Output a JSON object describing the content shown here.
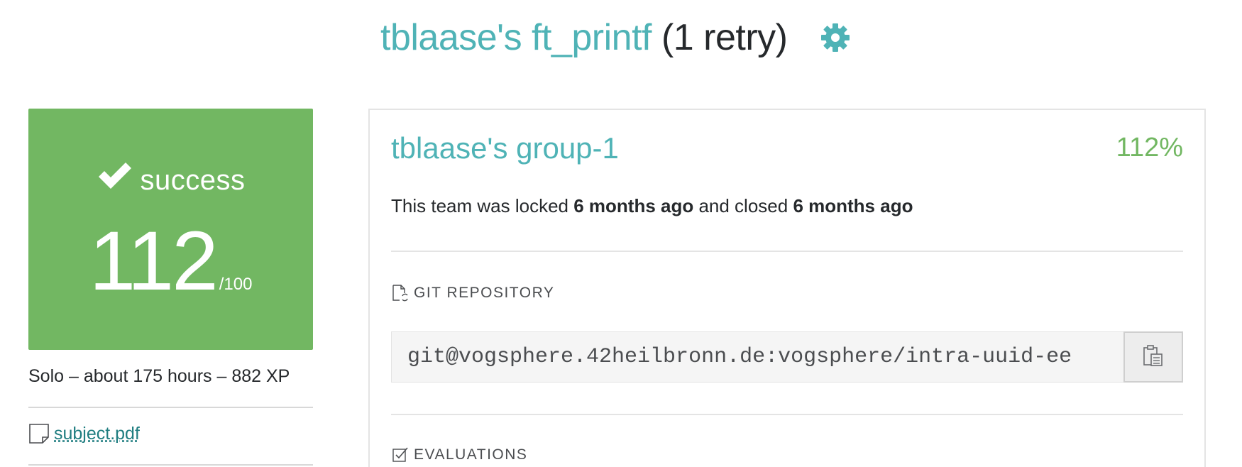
{
  "header": {
    "project_title": "tblaase's ft_printf",
    "retry_label": "(1 retry)",
    "settings_icon": "gear-icon"
  },
  "result": {
    "status_label": "success",
    "status_icon": "check-icon",
    "score": "112",
    "score_max": "/100",
    "color": "#72b762"
  },
  "project_meta": "Solo – about 175 hours – 882 XP",
  "subject": {
    "icon": "file-icon",
    "label": "subject.pdf"
  },
  "team": {
    "name": "tblaase's group-1",
    "final_mark": "112%",
    "status_prefix": "This team was locked ",
    "locked_time": "6 months ago",
    "status_middle": " and closed ",
    "closed_time": "6 months ago"
  },
  "git_repository": {
    "section_title": "GIT REPOSITORY",
    "icon": "repository-icon",
    "url": "git@vogsphere.42heilbronn.de:vogsphere/intra-uuid-ee",
    "copy_icon": "clipboard-icon"
  },
  "evaluations": {
    "section_title": "EVALUATIONS",
    "icon": "checkbox-icon"
  },
  "colors": {
    "accent": "#4fb3b6",
    "success": "#72b762",
    "text": "#26292c"
  }
}
